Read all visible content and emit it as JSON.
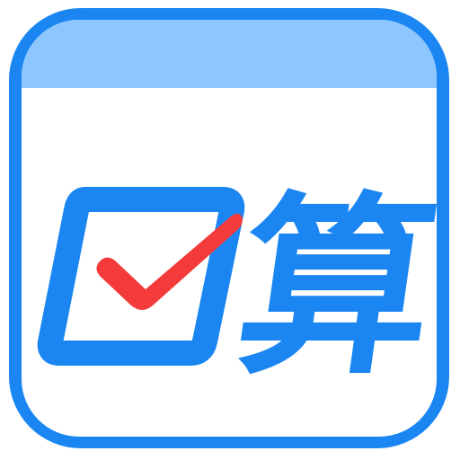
{
  "app_icon": {
    "glyph_text": "算",
    "colors": {
      "frame_blue": "#1b86f2",
      "header_blue": "#8ec6ff",
      "body_white": "#ffffff",
      "outer_background": "#ffffff",
      "check_red": "#f33b3b",
      "glyph_blue": "#1b86f2"
    },
    "icons": {
      "checkbox": "checkbox-icon",
      "checkmark": "checkmark-icon"
    }
  }
}
